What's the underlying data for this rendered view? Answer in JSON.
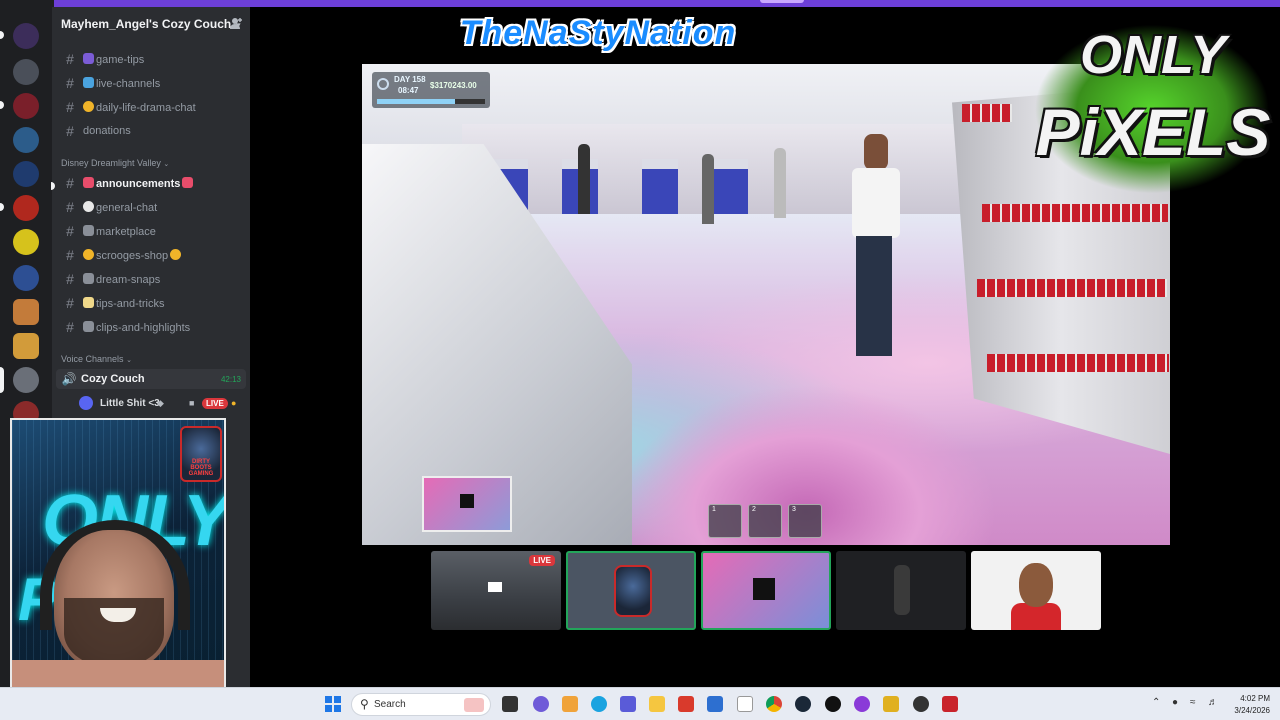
{
  "server": {
    "name": "Mayhem_Angel's Cozy Couch",
    "chevron": "chevron-down-icon",
    "invite_icon": "add-member-icon"
  },
  "channels": [
    {
      "name": "game-tips",
      "emoji_color": "#7b5cd6",
      "active": false
    },
    {
      "name": "live-channels",
      "emoji_color": "#4aa3df",
      "active": false
    },
    {
      "name": "daily-life-drama-chat",
      "emoji_color": "#f0b429",
      "active": false
    },
    {
      "name": "donations",
      "emoji_color": "",
      "active": false
    }
  ],
  "category_ddv": "Disney Dreamlight Valley",
  "ddv_channels": [
    {
      "name": "announcements",
      "emoji_color": "#e84d6b",
      "active": true
    },
    {
      "name": "general-chat",
      "emoji_color": "#e8e8e8",
      "active": false
    },
    {
      "name": "marketplace",
      "emoji_color": "#8a8f98",
      "active": false
    },
    {
      "name": "scrooges-shop",
      "emoji_color": "#f0b429",
      "active": false
    },
    {
      "name": "dream-snaps",
      "emoji_color": "#8a8f98",
      "active": false
    },
    {
      "name": "tips-and-tricks",
      "emoji_color": "#f0d88a",
      "active": false
    },
    {
      "name": "clips-and-highlights",
      "emoji_color": "#8a8f98",
      "active": false
    }
  ],
  "category_voice": "Voice Channels",
  "voice_channel": {
    "name": "Cozy Couch",
    "duration": "42:13"
  },
  "voice_user": {
    "name": "Little Shit <3",
    "live_label": "LIVE"
  },
  "stream": {
    "hud_day": "DAY 158",
    "hud_time": "08:47",
    "hud_money": "$3170243.00",
    "hud_progress": 0.72,
    "hotbar": [
      "1",
      "2",
      "3"
    ]
  },
  "logos": {
    "nasty_nation": "TheNaStyNation",
    "only_pixels_line1": "ONLY",
    "only_pixels_line2": "PiXELS",
    "cam_text1": "ONLY",
    "cam_text2": "PIX",
    "cam_badge": "DIRTY BOOTS GAMING"
  },
  "thumbnails": [
    {
      "live": "LIVE",
      "selected": false
    },
    {
      "live": "",
      "selected": true
    },
    {
      "live": "",
      "selected": true
    },
    {
      "live": "",
      "selected": false
    },
    {
      "live": "",
      "selected": false
    }
  ],
  "taskbar": {
    "search_placeholder": "Search",
    "time": "4:02 PM",
    "date": "3/24/2026"
  },
  "colors": {
    "accent": "#6d3fd8",
    "online_green": "#23a55a",
    "live_red": "#da373c"
  }
}
